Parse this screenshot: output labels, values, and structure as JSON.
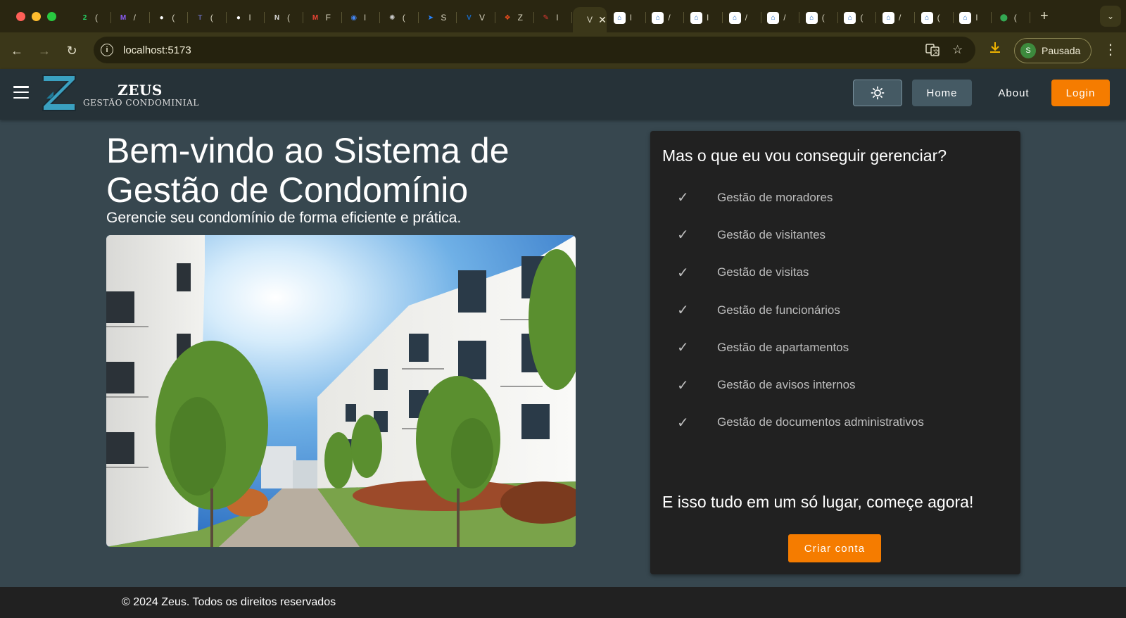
{
  "browser": {
    "tabs": [
      {
        "icon": "whatsapp-icon",
        "label": "(",
        "color": "#25d366",
        "glyph": "2"
      },
      {
        "icon": "messenger-icon",
        "label": "/",
        "color": "#8a5cf6",
        "glyph": "M"
      },
      {
        "icon": "github-icon",
        "label": "(",
        "color": "#ffffff",
        "glyph": "●"
      },
      {
        "icon": "teams-icon",
        "label": "(",
        "color": "#6264a7",
        "glyph": "T"
      },
      {
        "icon": "github-icon",
        "label": "I",
        "color": "#ffffff",
        "glyph": "●"
      },
      {
        "icon": "notion-icon",
        "label": "(",
        "color": "#dddddd",
        "glyph": "N"
      },
      {
        "icon": "gmail-icon",
        "label": "F",
        "color": "#ea4335",
        "glyph": "M"
      },
      {
        "icon": "chrome-app-icon",
        "label": "l",
        "color": "#4285f4",
        "glyph": "◉"
      },
      {
        "icon": "openai-icon",
        "label": "(",
        "color": "#cccccc",
        "glyph": "✺"
      },
      {
        "icon": "jira-icon",
        "label": "S",
        "color": "#2684ff",
        "glyph": "➤"
      },
      {
        "icon": "vuetify-icon",
        "label": "V",
        "color": "#1867c0",
        "glyph": "V"
      },
      {
        "icon": "figma-icon",
        "label": "Z",
        "color": "#f24e1e",
        "glyph": "❖"
      },
      {
        "icon": "pin-icon",
        "label": "I",
        "color": "#e53935",
        "glyph": "✎"
      },
      {
        "icon": "vite-tab-icon",
        "label": "V",
        "color": "#3b3719",
        "glyph": "",
        "active": true
      },
      {
        "icon": "house-icon",
        "label": "I",
        "color": "#1565c0",
        "glyph": "⌂"
      },
      {
        "icon": "house-icon",
        "label": "/",
        "color": "#1565c0",
        "glyph": "⌂"
      },
      {
        "icon": "house-icon",
        "label": "I",
        "color": "#1565c0",
        "glyph": "⌂"
      },
      {
        "icon": "house-icon",
        "label": "/",
        "color": "#1565c0",
        "glyph": "⌂"
      },
      {
        "icon": "house-icon",
        "label": "/",
        "color": "#1565c0",
        "glyph": "⌂"
      },
      {
        "icon": "house-icon",
        "label": "(",
        "color": "#1565c0",
        "glyph": "⌂"
      },
      {
        "icon": "house-icon",
        "label": "(",
        "color": "#1565c0",
        "glyph": "⌂"
      },
      {
        "icon": "house-icon",
        "label": "/",
        "color": "#1565c0",
        "glyph": "⌂"
      },
      {
        "icon": "house-icon",
        "label": "(",
        "color": "#1565c0",
        "glyph": "⌂"
      },
      {
        "icon": "house-icon",
        "label": "I",
        "color": "#1565c0",
        "glyph": "⌂"
      },
      {
        "icon": "maps-icon",
        "label": "(",
        "color": "#34a853",
        "glyph": "⬤"
      }
    ],
    "url": "localhost:5173",
    "profile_initial": "S",
    "profile_label": "Pausada"
  },
  "app": {
    "brand_name": "ZEUS",
    "brand_sub": "GESTÃO CONDOMINIAL",
    "nav": {
      "home": "Home",
      "about": "About",
      "login": "Login"
    },
    "hero": {
      "title": "Bem-vindo ao Sistema de Gestão de Condomínio",
      "subtitle": "Gerencie seu condomínio de forma eficiente e prática."
    },
    "card": {
      "title": "Mas o que eu vou conseguir gerenciar?",
      "features": [
        "Gestão de moradores",
        "Gestão de visitantes",
        "Gestão de visitas",
        "Gestão de funcionários",
        "Gestão de apartamentos",
        "Gestão de avisos internos",
        "Gestão de documentos administrativos"
      ],
      "cta": "E isso tudo em um só lugar, começe agora!",
      "button": "Criar conta"
    },
    "footer": "© 2024 Zeus. Todos os direitos reservados"
  },
  "colors": {
    "accent": "#f57c00",
    "appbar": "#263238",
    "background": "#37474f",
    "card": "#212121"
  }
}
